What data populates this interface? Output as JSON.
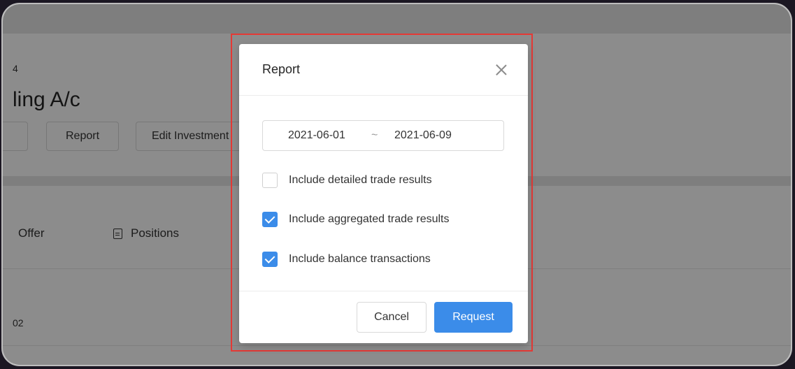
{
  "background_page": {
    "breadcrumb_fragment": "4",
    "title_fragment": "ling A/c",
    "buttons": [
      "",
      "Report",
      "Edit Investment"
    ],
    "tabs": [
      "Offer",
      "Positions"
    ],
    "row_fragment": "02"
  },
  "modal": {
    "title": "Report",
    "date_range": {
      "start": "2021-06-01",
      "separator": "~",
      "end": "2021-06-09"
    },
    "options": [
      {
        "label": "Include detailed trade results",
        "checked": false
      },
      {
        "label": "Include aggregated trade results",
        "checked": true
      },
      {
        "label": "Include balance transactions",
        "checked": true
      }
    ],
    "cancel_label": "Cancel",
    "request_label": "Request"
  },
  "colors": {
    "primary": "#3b8ce9",
    "highlight": "#e53935"
  }
}
